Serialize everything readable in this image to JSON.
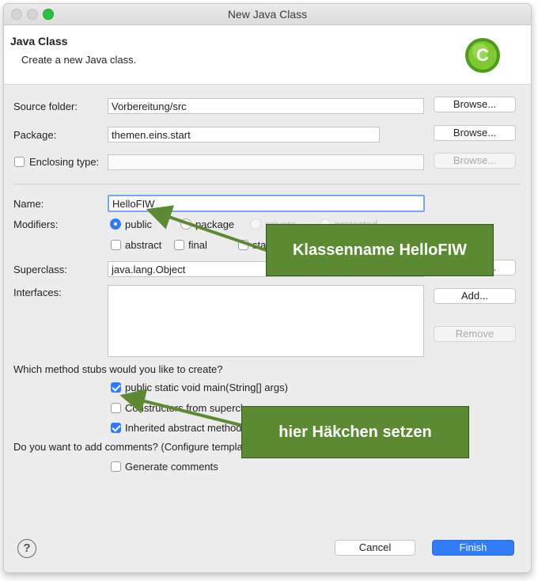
{
  "window": {
    "title": "New Java Class",
    "traffic_lights": [
      "#d4d4d4",
      "#d4d4d4",
      "#2bc140"
    ]
  },
  "header": {
    "title": "Java Class",
    "subtitle": "Create a new Java class.",
    "icon": "java-class-wizard-icon",
    "icon_letter": "C"
  },
  "form": {
    "source_folder": {
      "label": "Source folder:",
      "value": "Vorbereitung/src",
      "browse": "Browse..."
    },
    "package": {
      "label": "Package:",
      "value": "themen.eins.start",
      "browse": "Browse..."
    },
    "enclosing_type": {
      "label": "Enclosing type:",
      "value": "",
      "browse": "Browse...",
      "checked": false
    },
    "name": {
      "label": "Name:",
      "value": "HelloFIW"
    },
    "modifiers": {
      "label": "Modifiers:",
      "radios": [
        {
          "label": "public",
          "selected": true,
          "enabled": true
        },
        {
          "label": "package",
          "selected": false,
          "enabled": true
        },
        {
          "label": "private",
          "selected": false,
          "enabled": false
        },
        {
          "label": "protected",
          "selected": false,
          "enabled": false
        }
      ],
      "checks": [
        {
          "label": "abstract",
          "checked": false
        },
        {
          "label": "final",
          "checked": false
        },
        {
          "label": "static",
          "checked": false
        }
      ]
    },
    "superclass": {
      "label": "Superclass:",
      "value": "java.lang.Object",
      "browse": "Browse..."
    },
    "interfaces": {
      "label": "Interfaces:",
      "add": "Add...",
      "remove": "Remove"
    },
    "stubs": {
      "question": "Which method stubs would you like to create?",
      "options": [
        {
          "label": "public static void main(String[] args)",
          "checked": true
        },
        {
          "label": "Constructors from superclass",
          "checked": false
        },
        {
          "label": "Inherited abstract methods",
          "checked": true
        }
      ]
    },
    "comments": {
      "question": "Do you want to add comments? (Configure templates and default value here)",
      "option": {
        "label": "Generate comments",
        "checked": false
      }
    }
  },
  "footer": {
    "help": "?",
    "cancel": "Cancel",
    "finish": "Finish"
  },
  "annotations": {
    "callout_1": "Klassenname HelloFIW",
    "callout_2": "hier Häkchen setzen",
    "color": "#5b8a32"
  },
  "colors": {
    "accent": "#2f7cf6",
    "callout": "#5b8a32"
  }
}
